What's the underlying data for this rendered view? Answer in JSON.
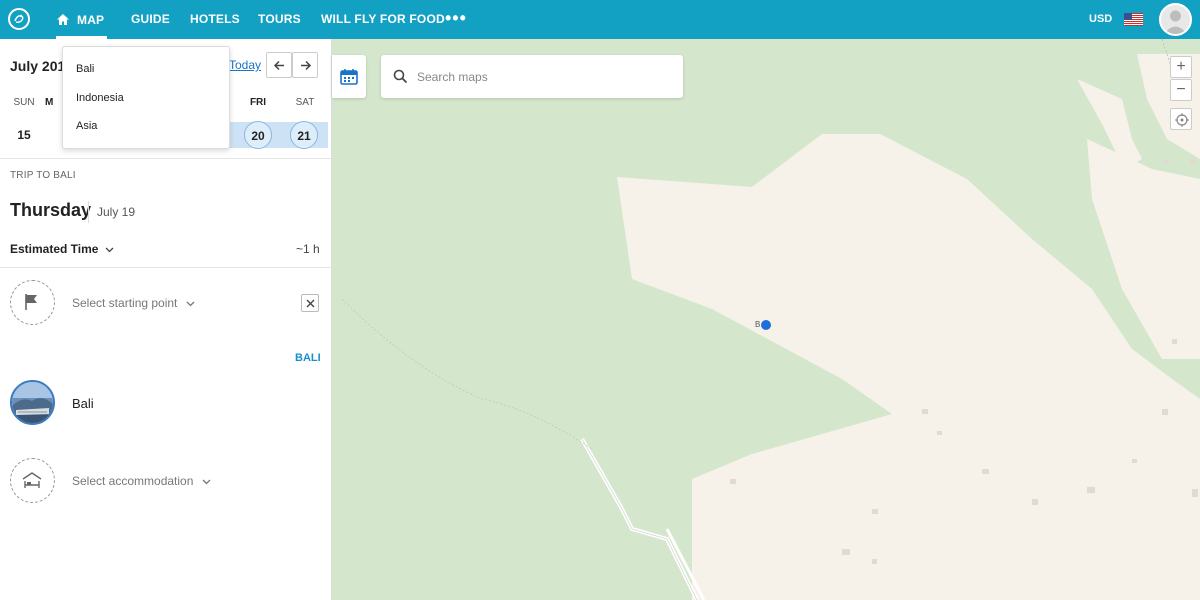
{
  "nav": {
    "items": [
      "MAP",
      "GUIDE",
      "HOTELS",
      "TOURS",
      "WILL FLY FOR FOOD"
    ],
    "more": "•••",
    "currency": "USD",
    "accent": "#12a1c3"
  },
  "calendar": {
    "month": "July 2018",
    "today": "Today",
    "days": [
      "SUN",
      "M",
      "FRI",
      "SAT"
    ],
    "dates": [
      "15",
      "20",
      "21"
    ]
  },
  "dropdown": {
    "items": [
      "Bali",
      "Indonesia",
      "Asia"
    ]
  },
  "trip": {
    "label": "TRIP TO BALI",
    "day": "Thursday",
    "date": "July 19",
    "estimated_label": "Estimated Time",
    "estimated_value": "~1 h",
    "starting_point": "Select starting point",
    "region": "BALI",
    "place": "Bali",
    "accommodation": "Select accommodation"
  },
  "map": {
    "search_placeholder": "Search maps",
    "zoom_in": "+",
    "zoom_out": "−",
    "pin_label": "B"
  }
}
